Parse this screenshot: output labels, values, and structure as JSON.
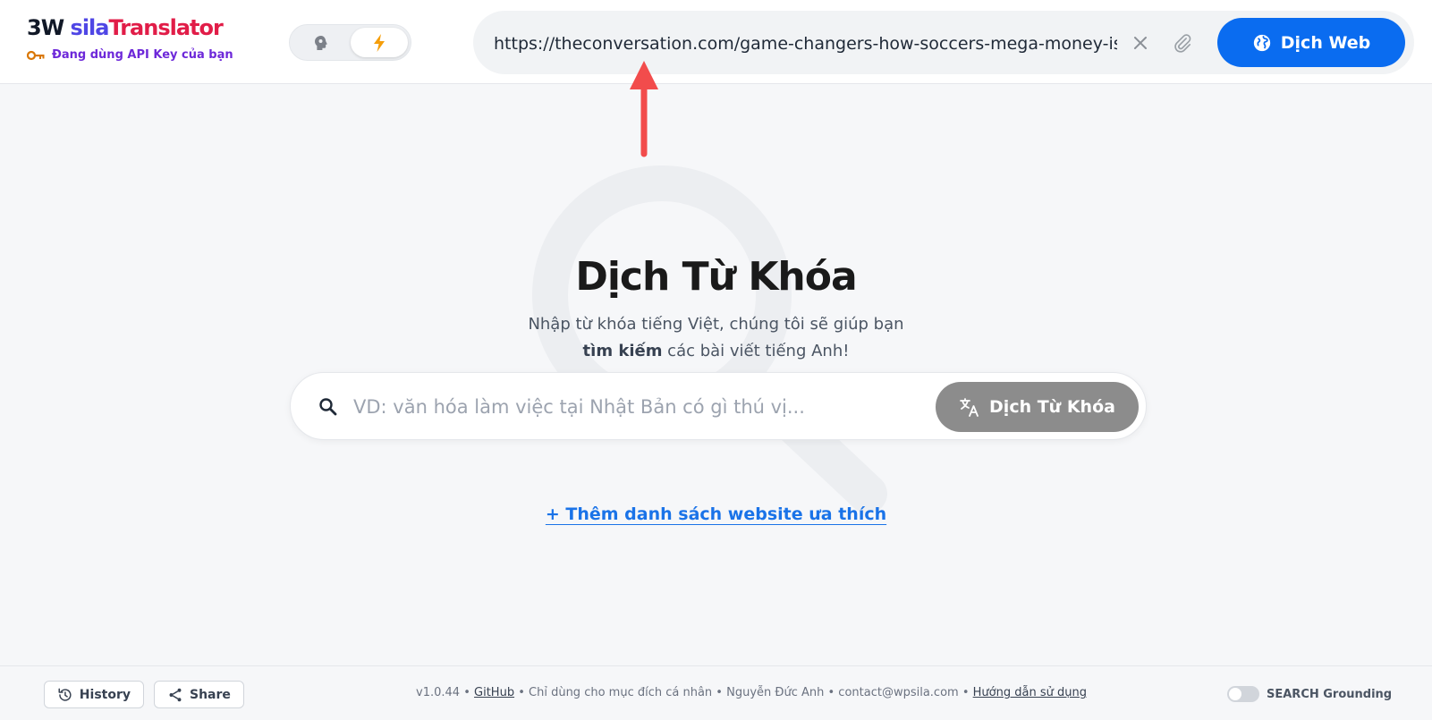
{
  "brand": {
    "logo_prefix": "3W ",
    "logo_sila": "sila",
    "logo_translator": "Translator",
    "api_status": "Đang dùng API Key của bạn"
  },
  "mode_toggle": {
    "left_icon": "brain-icon",
    "right_icon": "lightning-icon",
    "active": "right"
  },
  "url_bar": {
    "value": "https://theconversation.com/game-changers-how-soccers-mega-money-is-reshaping-the-world",
    "clear_icon": "close-icon",
    "attach_icon": "paperclip-icon",
    "button_label": "Dịch Web",
    "button_icon": "globe-icon"
  },
  "hero": {
    "title": "Dịch Từ Khóa",
    "subtitle_line1": "Nhập từ khóa tiếng Việt, chúng tôi sẽ giúp bạn",
    "subtitle_bold": "tìm kiếm",
    "subtitle_rest": " các bài viết tiếng Anh!"
  },
  "search": {
    "placeholder": "VD: văn hóa làm việc tại Nhật Bản có gì thú vị...",
    "value": "",
    "button_label": "Dịch Từ Khóa",
    "button_icon": "translate-icon"
  },
  "add_favorites": "+ Thêm danh sách website ưa thích",
  "footer": {
    "history_label": "History",
    "share_label": "Share",
    "version": "v1.0.44",
    "sep": " • ",
    "github": "GitHub",
    "personal_use": "Chỉ dùng cho mục đích cá nhân",
    "author": "Nguyễn Đức Anh",
    "contact": "contact@wpsila.com",
    "guide": "Hướng dẫn sử dụng",
    "grounding_label": "SEARCH Grounding",
    "grounding_on": false
  },
  "colors": {
    "primary": "#0a6cf0",
    "logo_sila": "#4f46e5",
    "logo_translator": "#e11d48",
    "annotation_arrow": "#f24c4c",
    "keyword_button": "#8c8c8c"
  }
}
